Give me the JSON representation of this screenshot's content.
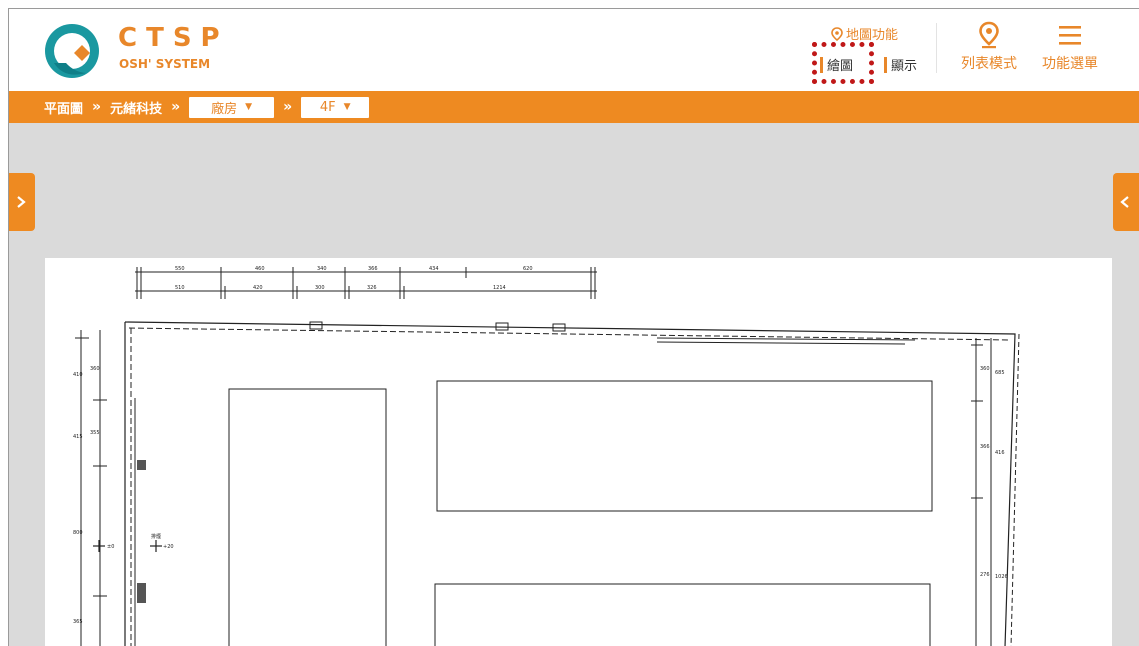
{
  "brand": {
    "name": "CTSP",
    "subtitle": "OSH' SYSTEM",
    "color": "#e8872a"
  },
  "header": {
    "map_function_label": "地圖功能",
    "draw_label": "繪圖",
    "show_label": "顯示",
    "list_mode_label": "列表模式",
    "function_menu_label": "功能選單",
    "icons": {
      "map_function": "location-pin-icon",
      "list_mode": "location-pin-icon",
      "function_menu": "hamburger-menu-icon"
    }
  },
  "breadcrumb": {
    "root": "平面圖",
    "company": "元緒科技",
    "plant_selected": "廠房",
    "floor_selected": "4F",
    "separator": "»"
  },
  "floor_plan": {
    "top_dims_row1": [
      "550",
      "460",
      "340",
      "366",
      "434",
      "620"
    ],
    "top_dims_row2": [
      "510",
      "420",
      "300",
      "326",
      "1214"
    ],
    "left_dims": [
      "410",
      "415",
      "800",
      "365"
    ],
    "left_small": [
      "360",
      "355"
    ],
    "right_dims": [
      "685",
      "416",
      "1026"
    ],
    "right_small": [
      "360",
      "366",
      "276"
    ],
    "label_near": "排煙",
    "elev_a": "±0",
    "elev_b": "+20"
  },
  "colors": {
    "accent": "#ee8a21",
    "highlight": "#c01818",
    "canvas_bg": "#dadada"
  }
}
